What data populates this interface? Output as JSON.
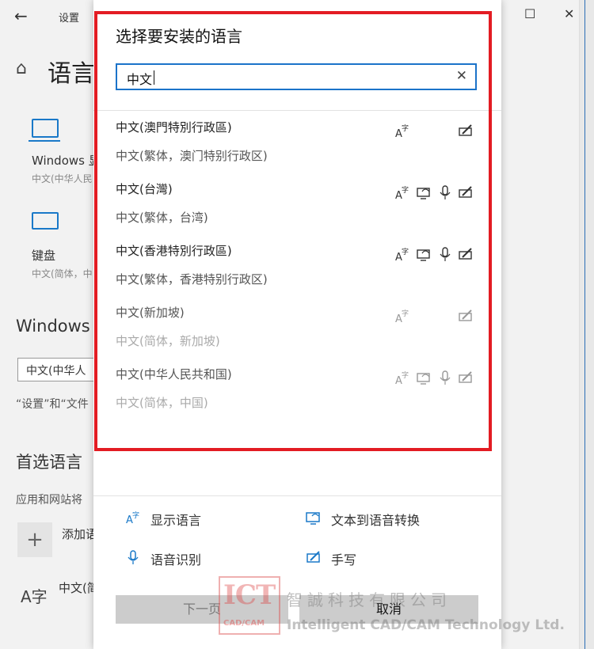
{
  "background": {
    "title": "设置",
    "heading": "语言",
    "display_label": "Windows 显",
    "display_sub": "中文(中华人民",
    "keyboard_label": "键盘",
    "keyboard_sub": "中文(简体，中",
    "windows_section": "Windows",
    "display_lang_select": "中文(中华人",
    "note_text": "“设置”和“文件",
    "preferred_section": "首选语言",
    "preferred_desc": "应用和网站将",
    "add_label": "添加语",
    "lang_entry": "中文(简"
  },
  "dialog": {
    "title": "选择要安装的语言",
    "search": {
      "value": "中文"
    },
    "languages": [
      {
        "name": "中文(澳門特別行政區)",
        "sub": "中文(繁体，澳门特别行政区)",
        "features": [
          "display-language-icon",
          "handwriting-icon"
        ]
      },
      {
        "name": "中文(台灣)",
        "sub": "中文(繁体，台湾)",
        "features": [
          "display-language-icon",
          "text-to-speech-icon",
          "speech-recognition-icon",
          "handwriting-icon"
        ]
      },
      {
        "name": "中文(香港特別行政區)",
        "sub": "中文(繁体，香港特别行政区)",
        "features": [
          "display-language-icon",
          "text-to-speech-icon",
          "speech-recognition-icon",
          "handwriting-icon"
        ]
      },
      {
        "name": "中文(新加坡)",
        "sub": "中文(简体，新加坡)",
        "features": [
          "display-language-icon",
          "handwriting-icon"
        ]
      },
      {
        "name": "中文(中华人民共和国)",
        "sub": "中文(简体，中国)",
        "features": [
          "display-language-icon",
          "text-to-speech-icon",
          "speech-recognition-icon",
          "handwriting-icon"
        ]
      }
    ],
    "legend": {
      "display_language": "显示语言",
      "text_to_speech": "文本到语音转换",
      "speech_recognition": "语音识别",
      "handwriting": "手写"
    },
    "next_button": "下一页",
    "cancel_button": "取消"
  },
  "watermark": {
    "logo_text": "ICT",
    "logo_sub": "CAD/CAM",
    "chinese": "智誠科技有限公司",
    "english": "Intelligent CAD/CAM Technology Ltd."
  },
  "colors": {
    "accent": "#1b73c9",
    "highlight": "#e31c23",
    "button": "#cccccc"
  }
}
